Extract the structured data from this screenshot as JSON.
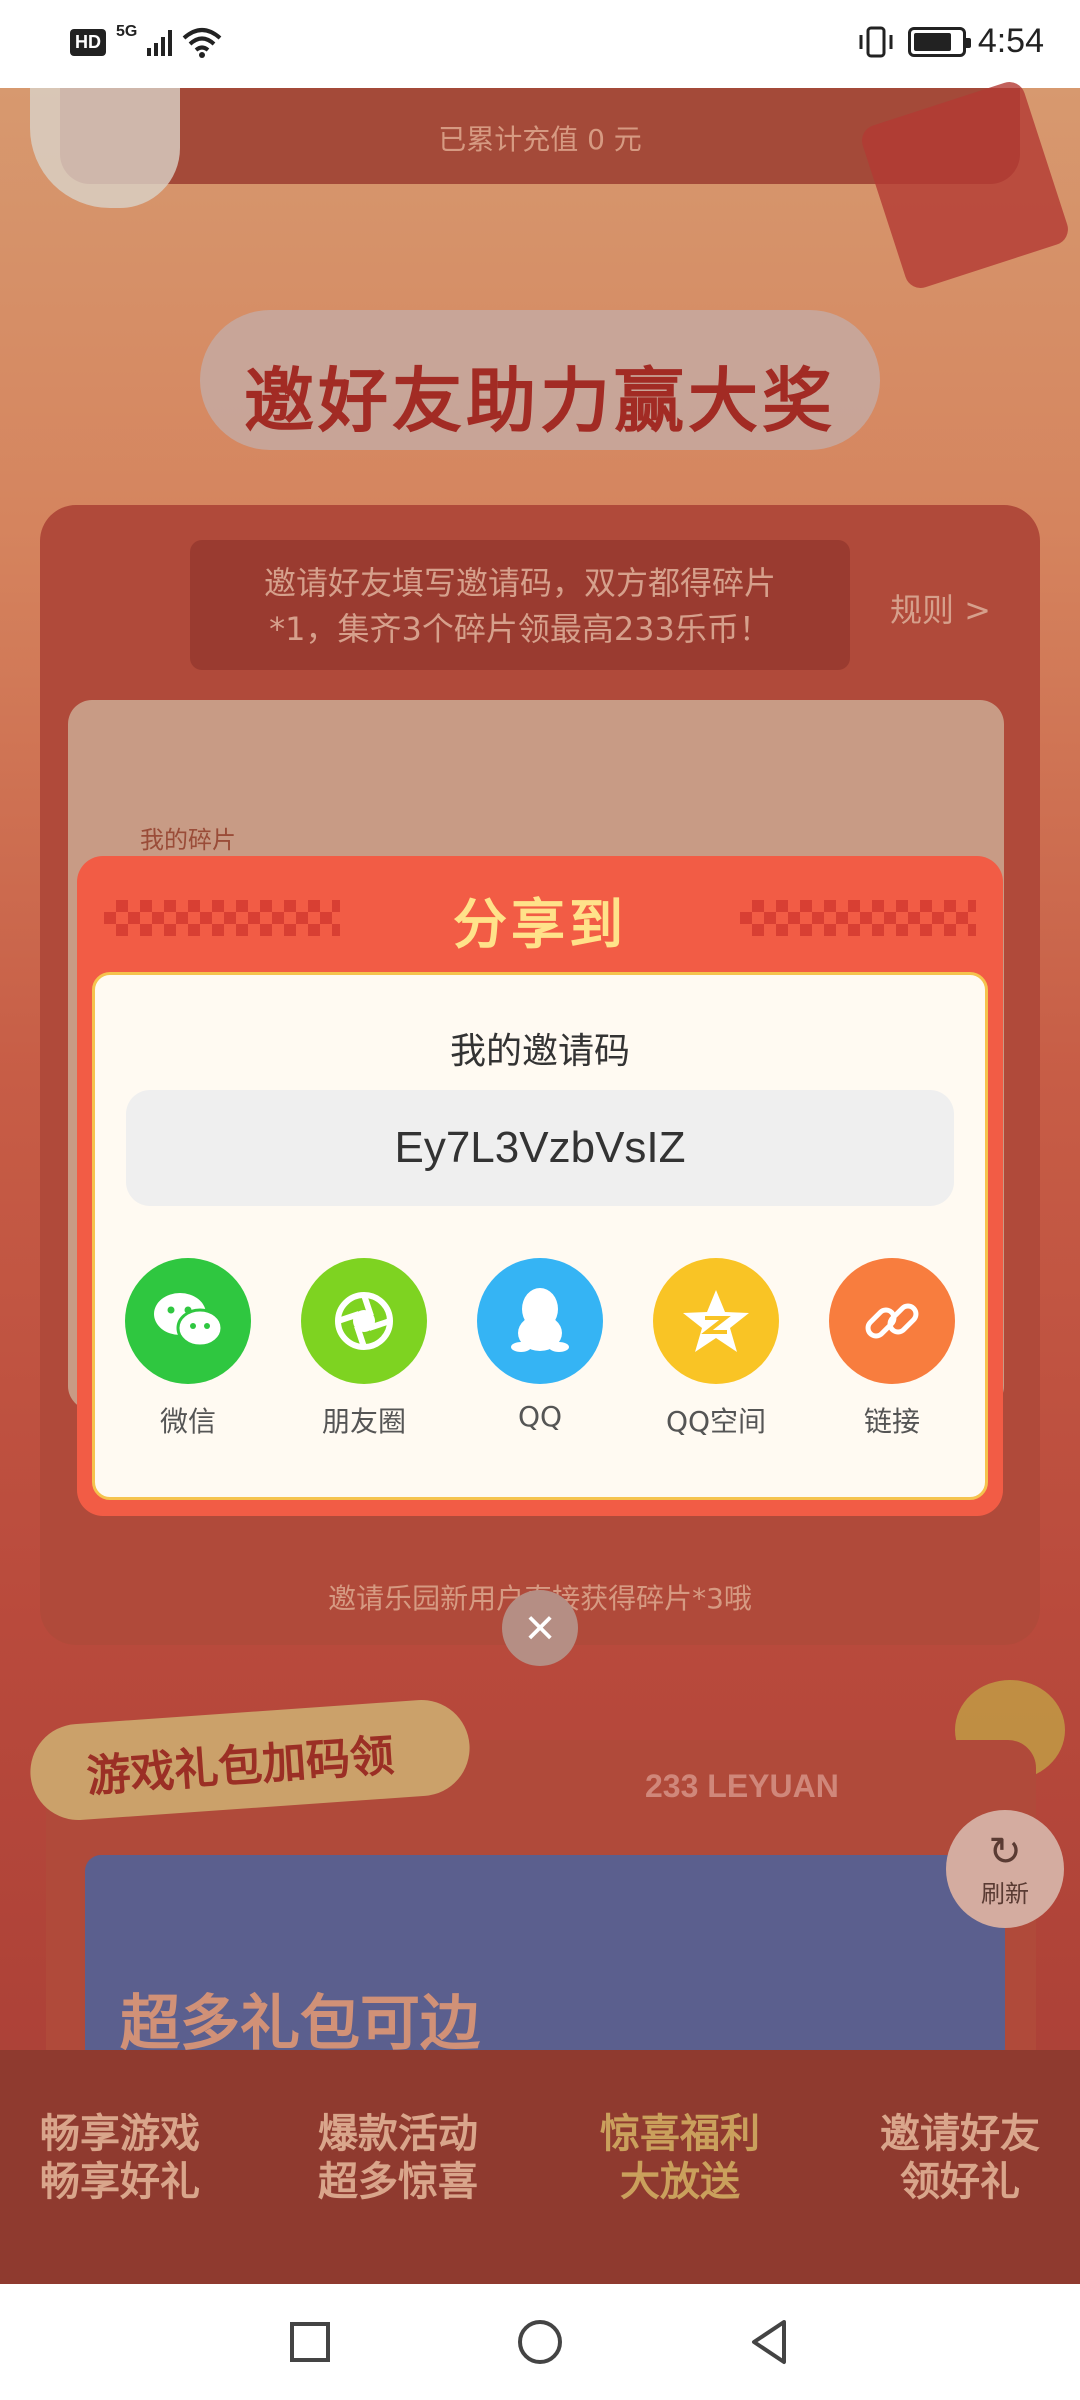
{
  "status_bar": {
    "hd": "HD",
    "network": "5G",
    "time": "4:54"
  },
  "background": {
    "recharge_text": "已累计充值 0 元",
    "main_title": "邀好友助力赢大奖",
    "invite_desc_line1": "邀请好友填写邀请码，双方都得碎片",
    "invite_desc_line2": "*1，集齐3个碎片领最高233乐币！",
    "rules_link": "规则 >",
    "shards_label": "我的碎片",
    "bottom_hint": "邀请乐园新用户直接获得碎片*3哦",
    "gift_section_title": "游戏礼包加码领",
    "brand_text": "233 LEYUAN",
    "banner_text": "超多礼包可边",
    "refresh_label": "刷新",
    "features": [
      {
        "line1": "畅享游戏",
        "line2": "畅享好礼"
      },
      {
        "line1": "爆款活动",
        "line2": "超多惊喜"
      },
      {
        "line1": "惊喜福利",
        "line2": "大放送"
      },
      {
        "line1": "邀请好友",
        "line2": "领好礼"
      }
    ]
  },
  "modal": {
    "title": "分享到",
    "code_label": "我的邀请码",
    "invite_code": "Ey7L3VzbVsIZ",
    "share_options": [
      {
        "label": "微信",
        "icon": "wechat-icon",
        "color": "#2fc740"
      },
      {
        "label": "朋友圈",
        "icon": "moments-icon",
        "color": "#7ed321"
      },
      {
        "label": "QQ",
        "icon": "qq-icon",
        "color": "#35b4f4"
      },
      {
        "label": "QQ空间",
        "icon": "qzone-icon",
        "color": "#f9c425"
      },
      {
        "label": "链接",
        "icon": "link-icon",
        "color": "#f87d3e"
      }
    ],
    "close_icon": "close-icon"
  },
  "nav_bar": {
    "recent_icon": "square-recent-icon",
    "home_icon": "circle-home-icon",
    "back_icon": "triangle-back-icon"
  }
}
